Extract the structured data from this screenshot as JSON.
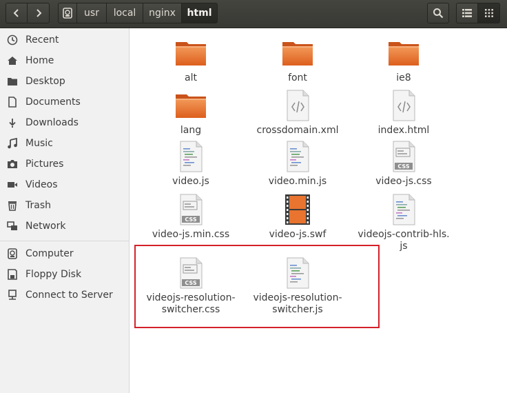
{
  "breadcrumbs": [
    "usr",
    "local",
    "nginx",
    "html"
  ],
  "sidebar": {
    "items": [
      {
        "label": "Recent",
        "icon": "clock-icon"
      },
      {
        "label": "Home",
        "icon": "home-icon"
      },
      {
        "label": "Desktop",
        "icon": "folder-icon"
      },
      {
        "label": "Documents",
        "icon": "document-icon"
      },
      {
        "label": "Downloads",
        "icon": "download-icon"
      },
      {
        "label": "Music",
        "icon": "music-icon"
      },
      {
        "label": "Pictures",
        "icon": "camera-icon"
      },
      {
        "label": "Videos",
        "icon": "video-icon"
      },
      {
        "label": "Trash",
        "icon": "trash-icon"
      },
      {
        "label": "Network",
        "icon": "network-icon"
      },
      {
        "label": "Computer",
        "icon": "computer-icon"
      },
      {
        "label": "Floppy Disk",
        "icon": "floppy-icon"
      },
      {
        "label": "Connect to Server",
        "icon": "server-icon"
      }
    ]
  },
  "files": [
    {
      "name": "alt",
      "type": "folder"
    },
    {
      "name": "font",
      "type": "folder"
    },
    {
      "name": "ie8",
      "type": "folder"
    },
    {
      "name": "lang",
      "type": "folder"
    },
    {
      "name": "crossdomain.xml",
      "type": "xml"
    },
    {
      "name": "index.html",
      "type": "html"
    },
    {
      "name": "video.js",
      "type": "js"
    },
    {
      "name": "video.min.js",
      "type": "js"
    },
    {
      "name": "video-js.css",
      "type": "css"
    },
    {
      "name": "video-js.min.css",
      "type": "css"
    },
    {
      "name": "video-js.swf",
      "type": "swf"
    },
    {
      "name": "videojs-contrib-hls.\njs",
      "type": "js"
    },
    {
      "name": "videojs-resolution-\nswitcher.css",
      "type": "css"
    },
    {
      "name": "videojs-resolution-\nswitcher.js",
      "type": "js"
    }
  ],
  "colors": {
    "header": "#3c3b37",
    "folder": "#e8742f",
    "highlight": "#d4202a"
  }
}
